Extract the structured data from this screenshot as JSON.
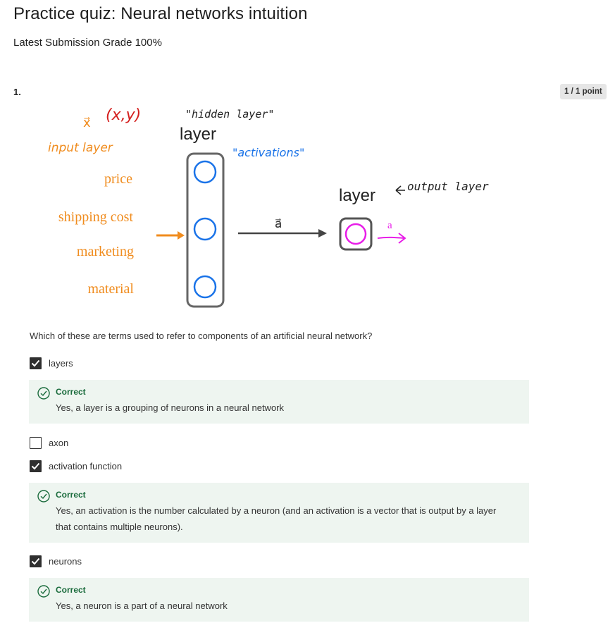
{
  "page": {
    "title": "Practice quiz: Neural networks intuition",
    "grade": "Latest Submission Grade 100%"
  },
  "question": {
    "number": "1.",
    "points": "1 / 1 point",
    "prompt": "Which of these are terms used to refer to components of an artificial neural network?",
    "diagram": {
      "xy": "(x,y)",
      "xvec": "x⃗",
      "hidden_note": "\"hidden layer\"",
      "layer_top": "layer",
      "input_note": "input layer",
      "activations_note": "\"activations\"",
      "features": [
        "price",
        "shipping cost",
        "marketing",
        "material"
      ],
      "avec": "a⃗",
      "layer_right": "layer",
      "output_note": "output layer",
      "a_out": "a"
    },
    "options": [
      {
        "label": "layers",
        "checked": true,
        "feedback": {
          "title": "Correct",
          "text": "Yes, a layer is a grouping of neurons in a neural network"
        }
      },
      {
        "label": "axon",
        "checked": false
      },
      {
        "label": "activation function",
        "checked": true,
        "feedback": {
          "title": "Correct",
          "text": "Yes, an activation is the number calculated by a neuron (and an activation is a vector that is output by a layer that contains multiple neurons)."
        }
      },
      {
        "label": "neurons",
        "checked": true,
        "feedback": {
          "title": "Correct",
          "text": "Yes, a neuron is a part of a neural network"
        }
      }
    ]
  },
  "colors": {
    "orange": "#f08c1e",
    "blue": "#1a73e8",
    "magenta": "#e81ee8",
    "correct_green": "#1a6b3c",
    "feedback_bg": "#eef5f0"
  }
}
